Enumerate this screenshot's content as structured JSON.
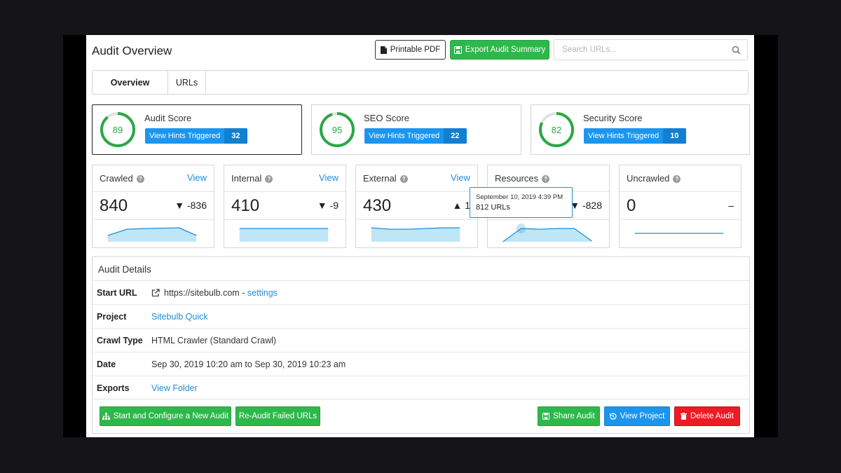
{
  "header": {
    "title": "Audit Overview",
    "pdf_label": "Printable PDF",
    "export_label": "Export Audit Summary",
    "search_placeholder": "Search URLs..."
  },
  "tabs": [
    {
      "label": "Overview",
      "active": true
    },
    {
      "label": "URLs",
      "active": false
    }
  ],
  "scores": [
    {
      "name": "Audit Score",
      "value": "89",
      "percent": 89,
      "hints_label": "View Hints Triggered",
      "hints_count": "32"
    },
    {
      "name": "SEO Score",
      "value": "95",
      "percent": 95,
      "hints_label": "View Hints Triggered",
      "hints_count": "22"
    },
    {
      "name": "Security Score",
      "value": "82",
      "percent": 82,
      "hints_label": "View Hints Triggered",
      "hints_count": "10"
    }
  ],
  "metrics": [
    {
      "name": "Crawled",
      "view": "View",
      "value": "840",
      "delta": "▼ -836"
    },
    {
      "name": "Internal",
      "view": "View",
      "value": "410",
      "delta": "▼ -9"
    },
    {
      "name": "External",
      "view": "View",
      "value": "430",
      "delta": "▲ 1"
    },
    {
      "name": "Resources",
      "view": "",
      "value": "",
      "delta": "▼ -828"
    },
    {
      "name": "Uncrawled",
      "view": "",
      "value": "0",
      "delta": "–"
    }
  ],
  "tooltip": {
    "date": "September 10, 2019 4:39 PM",
    "count": "812 URLs"
  },
  "details": {
    "title": "Audit Details",
    "rows": {
      "start_url": {
        "label": "Start URL",
        "url": "https://sitebulb.com",
        "sep": " - ",
        "link": "settings"
      },
      "project": {
        "label": "Project",
        "value": "Sitebulb Quick"
      },
      "crawl_type": {
        "label": "Crawl Type",
        "value": "HTML Crawler (Standard Crawl)"
      },
      "date": {
        "label": "Date",
        "value": "Sep 30, 2019 10:20 am to Sep 30, 2019 10:23 am"
      },
      "exports": {
        "label": "Exports",
        "value": "View Folder"
      }
    }
  },
  "actions": {
    "start_new": "Start and Configure a New Audit",
    "reaudit": "Re-Audit Failed URLs",
    "share": "Share Audit",
    "view_project": "View Project",
    "delete": "Delete Audit"
  },
  "colors": {
    "green": "#2db84b",
    "blue": "#1b95ee",
    "red": "#ec1b24",
    "ring_green": "#2aa845",
    "spark_fill": "#bfe6f7",
    "spark_line": "#1e8ed7"
  }
}
